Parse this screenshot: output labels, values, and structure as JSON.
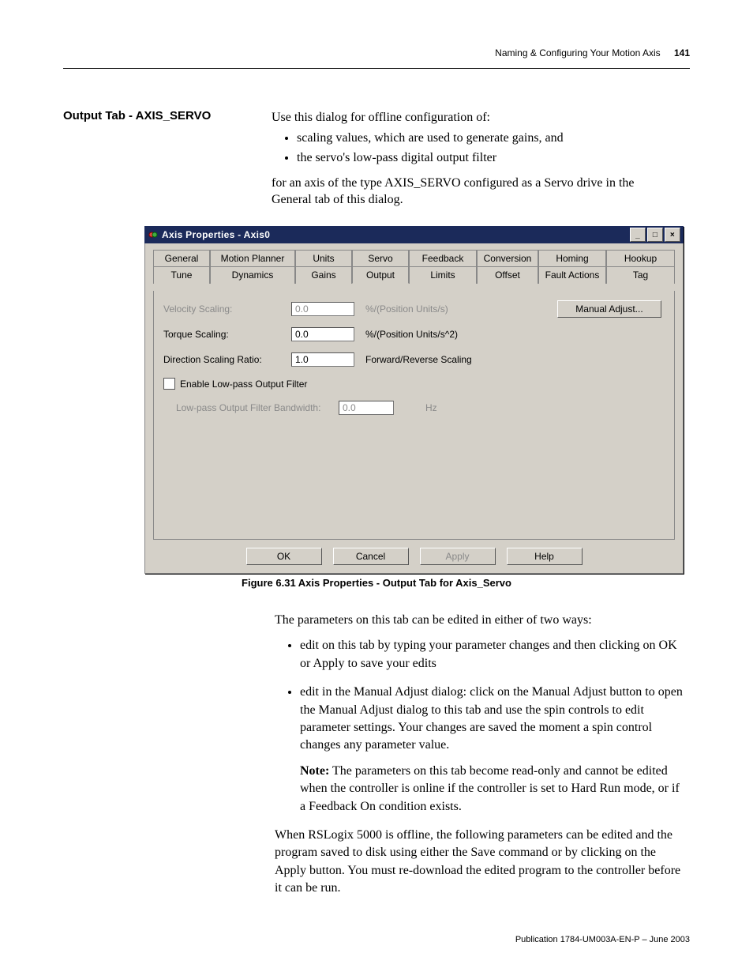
{
  "header": {
    "chapter": "Naming & Configuring Your Motion Axis",
    "page": "141"
  },
  "section_title": "Output Tab - AXIS_SERVO",
  "intro": {
    "lead": "Use this dialog for offline configuration of:",
    "bullets": [
      "scaling values, which are used to generate gains, and",
      "the servo's low-pass digital output filter"
    ],
    "tail": "for an axis of the type AXIS_SERVO configured as a Servo drive in the General tab of this dialog."
  },
  "dialog": {
    "title": "Axis Properties - Axis0",
    "win_min": "_",
    "win_max": "□",
    "win_close": "×",
    "tabs_row1": [
      "General",
      "Motion Planner",
      "Units",
      "Servo",
      "Feedback",
      "Conversion",
      "Homing",
      "Hookup"
    ],
    "tabs_row2": [
      "Tune",
      "Dynamics",
      "Gains",
      "Output",
      "Limits",
      "Offset",
      "Fault Actions",
      "Tag"
    ],
    "active_tab": "Output",
    "fields": {
      "velocity_label": "Velocity Scaling:",
      "velocity_value": "0.0",
      "velocity_unit": "%/(Position Units/s)",
      "torque_label": "Torque Scaling:",
      "torque_value": "0.0",
      "torque_unit": "%/(Position Units/s^2)",
      "dir_label": "Direction Scaling Ratio:",
      "dir_value": "1.0",
      "dir_unit": "Forward/Reverse Scaling",
      "enable_lp_label": "Enable Low-pass Output Filter",
      "lp_bw_label": "Low-pass Output Filter Bandwidth:",
      "lp_bw_value": "0.0",
      "lp_bw_unit": "Hz"
    },
    "manual_adjust": "Manual Adjust...",
    "buttons": {
      "ok": "OK",
      "cancel": "Cancel",
      "apply": "Apply",
      "help": "Help"
    }
  },
  "figure_caption": "Figure 6.31 Axis Properties - Output Tab for Axis_Servo",
  "body2": {
    "lead": "The parameters on this tab can be edited in either of two ways:",
    "items": [
      "edit on this tab by typing your parameter changes and then clicking on OK or Apply to save your edits",
      "edit in the Manual Adjust dialog: click on the Manual Adjust button to open the Manual Adjust dialog to this tab and use the spin controls to edit parameter settings. Your changes are saved the moment a spin control changes any parameter value."
    ],
    "note_label": "Note:",
    "note_text": " The parameters on this tab become read-only and cannot be edited when the controller is online if the controller is set to Hard Run mode, or if a Feedback On condition exists.",
    "tail": "When RSLogix 5000 is offline, the following parameters can be edited and the program saved to disk using either the Save command or by clicking on the Apply button. You must re-download the edited program to the controller before it can be run."
  },
  "footer": "Publication 1784-UM003A-EN-P – June 2003"
}
